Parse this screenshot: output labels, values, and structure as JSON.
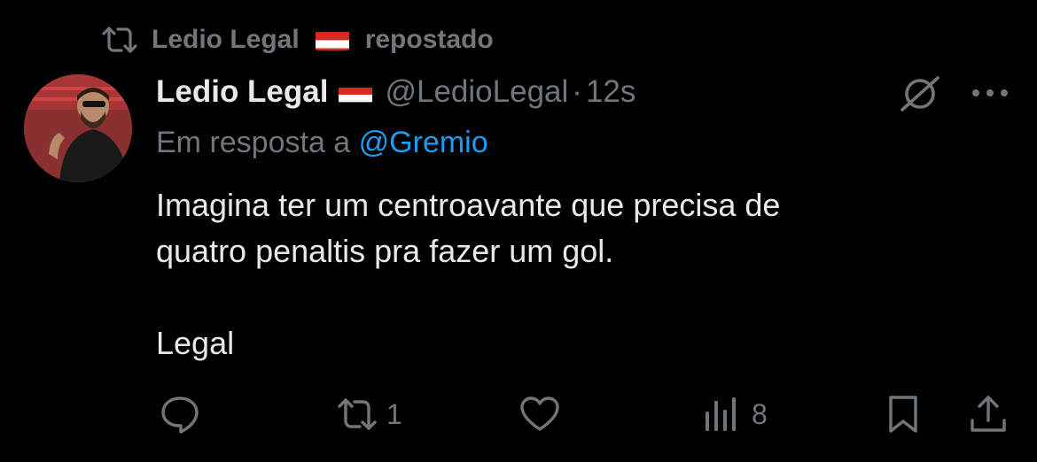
{
  "repost": {
    "name": "Ledio Legal",
    "label": "repostado"
  },
  "tweet": {
    "display_name": "Ledio Legal",
    "handle": "@LedioLegal",
    "separator": "·",
    "time": "12s",
    "reply_prefix": "Em resposta a",
    "reply_to": "@Gremio",
    "text": "Imagina ter um centroavante que precisa de\nquatro penaltis pra fazer um gol.\n\nLegal"
  },
  "actions": {
    "reposts": "1",
    "views": "8"
  },
  "icons": [
    "repost-icon",
    "flag-icon",
    "grok-icon",
    "more-icon",
    "reply-icon",
    "like-icon",
    "views-icon",
    "bookmark-icon",
    "share-icon"
  ],
  "colors": {
    "background": "#000000",
    "text": "#e7e9ea",
    "muted": "#71767b",
    "link": "#1d9bf0",
    "flag_red": "#d52b1e"
  }
}
